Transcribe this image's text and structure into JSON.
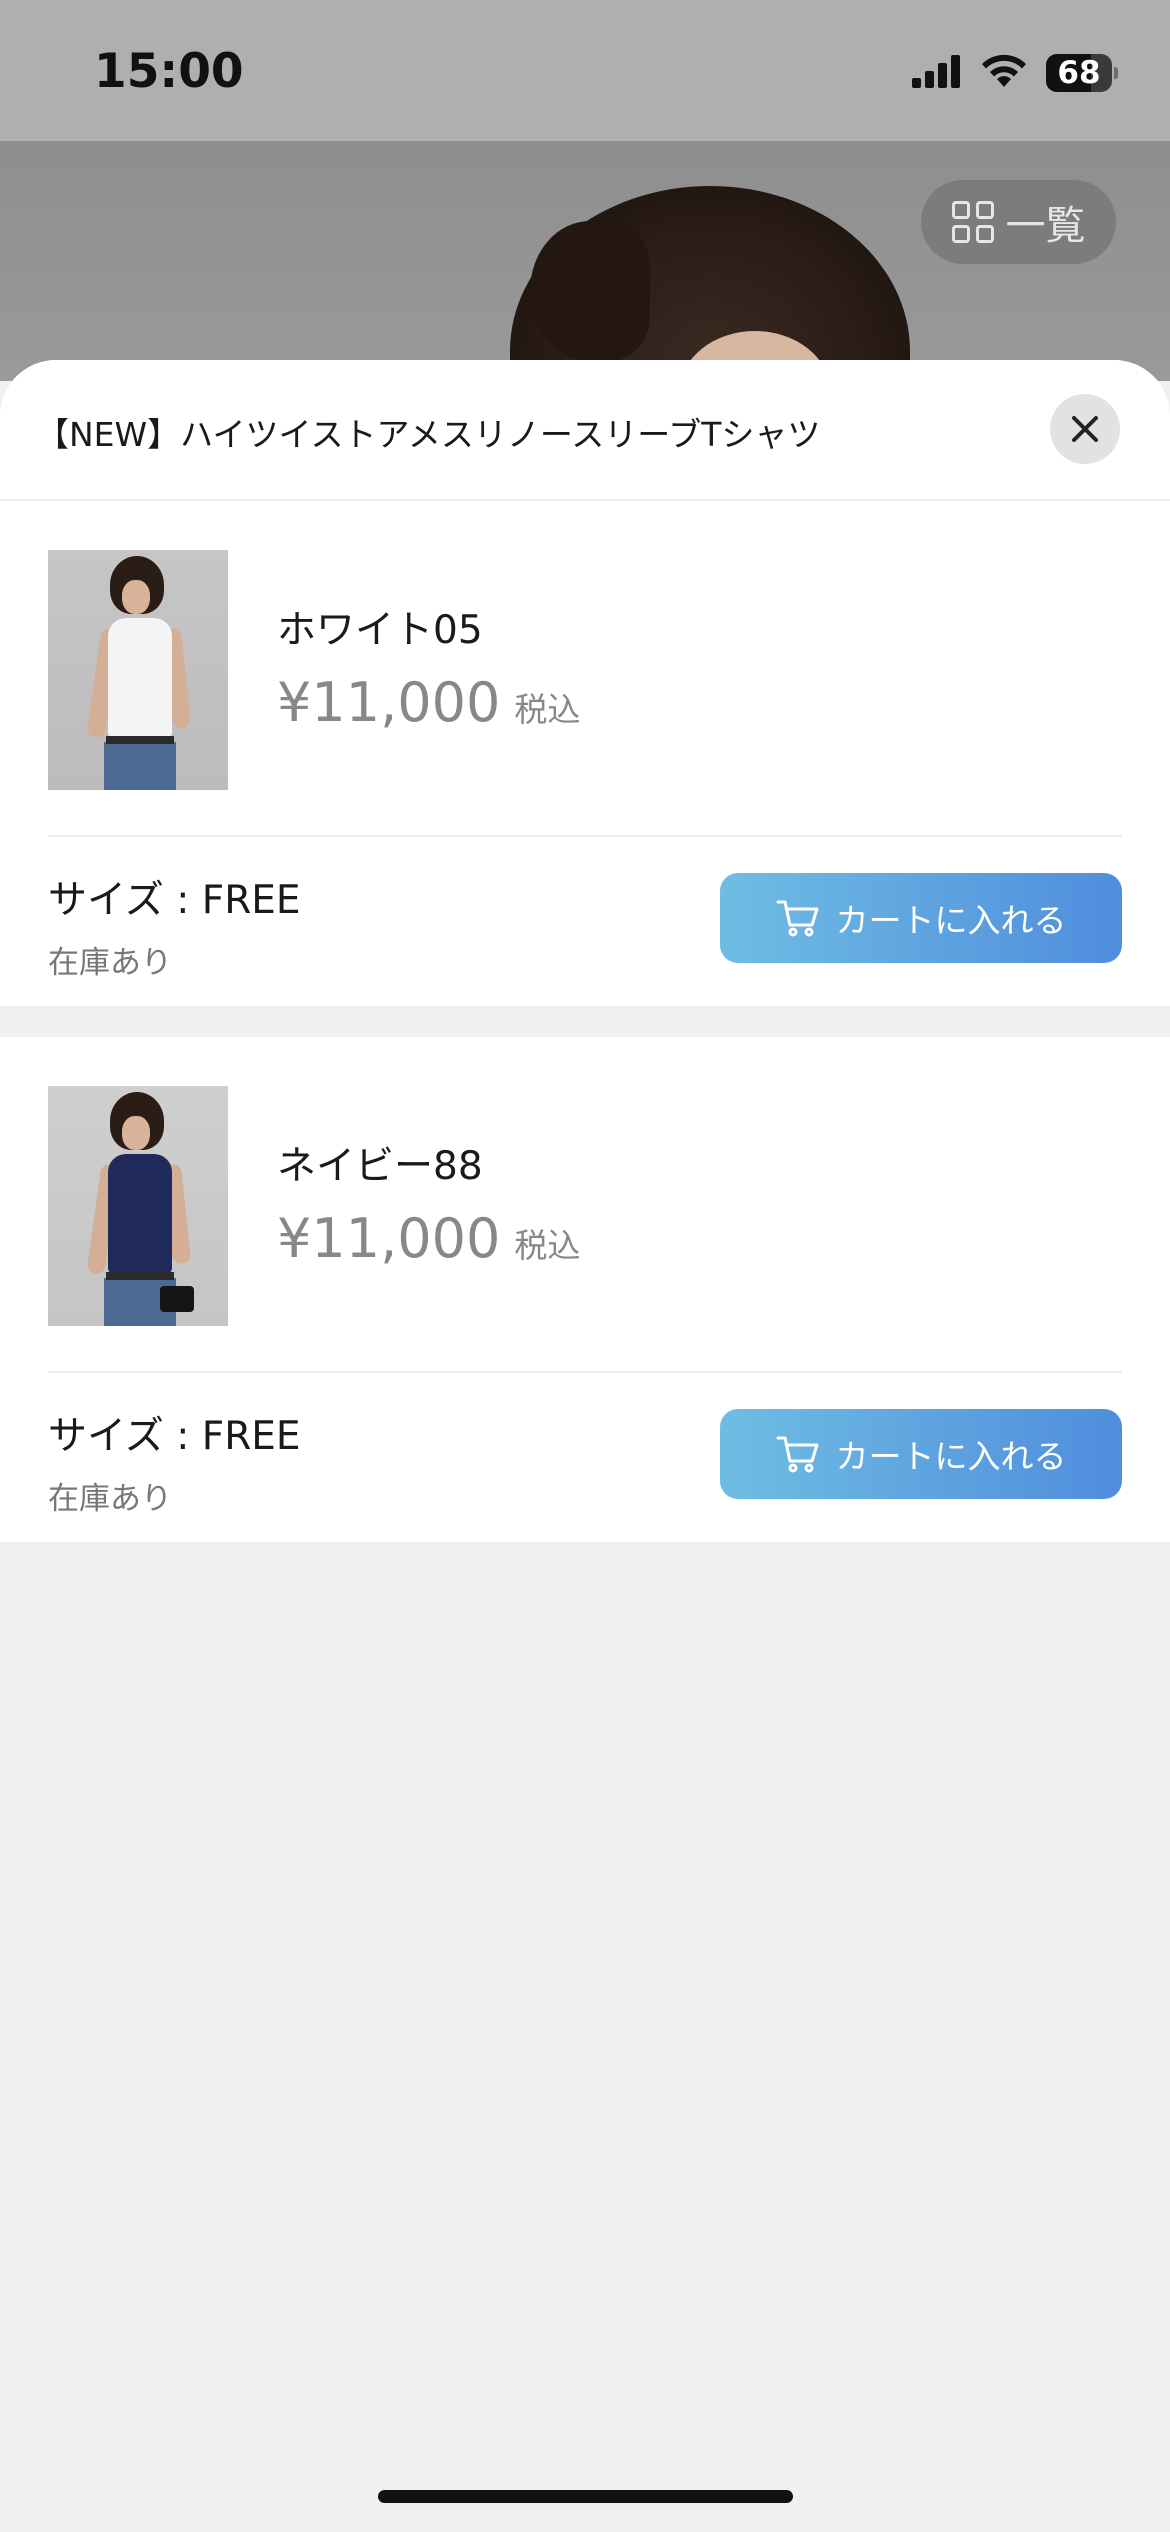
{
  "status_bar": {
    "time": "15:00",
    "battery_level": "68"
  },
  "hero": {
    "list_button_label": "一覧"
  },
  "sheet": {
    "title": "【NEW】ハイツイストアメスリノースリーブTシャツ",
    "products": [
      {
        "color": "ホワイト05",
        "price": "¥11,000",
        "tax_label": "税込",
        "size": "サイズ : FREE",
        "stock": "在庫あり",
        "cart_label": "カートに入れる"
      },
      {
        "color": "ネイビー88",
        "price": "¥11,000",
        "tax_label": "税込",
        "size": "サイズ : FREE",
        "stock": "在庫あり",
        "cart_label": "カートに入れる"
      }
    ]
  },
  "icons": {
    "cellular": "signal-bars-icon",
    "wifi": "wifi-icon",
    "battery": "battery-icon",
    "grid": "grid-icon",
    "close": "close-icon",
    "cart": "cart-icon"
  },
  "colors": {
    "cart_button_start": "#6fbde3",
    "cart_button_end": "#4f8ddd",
    "price_gray": "#888888",
    "sheet_background": "#f0f0f0"
  }
}
